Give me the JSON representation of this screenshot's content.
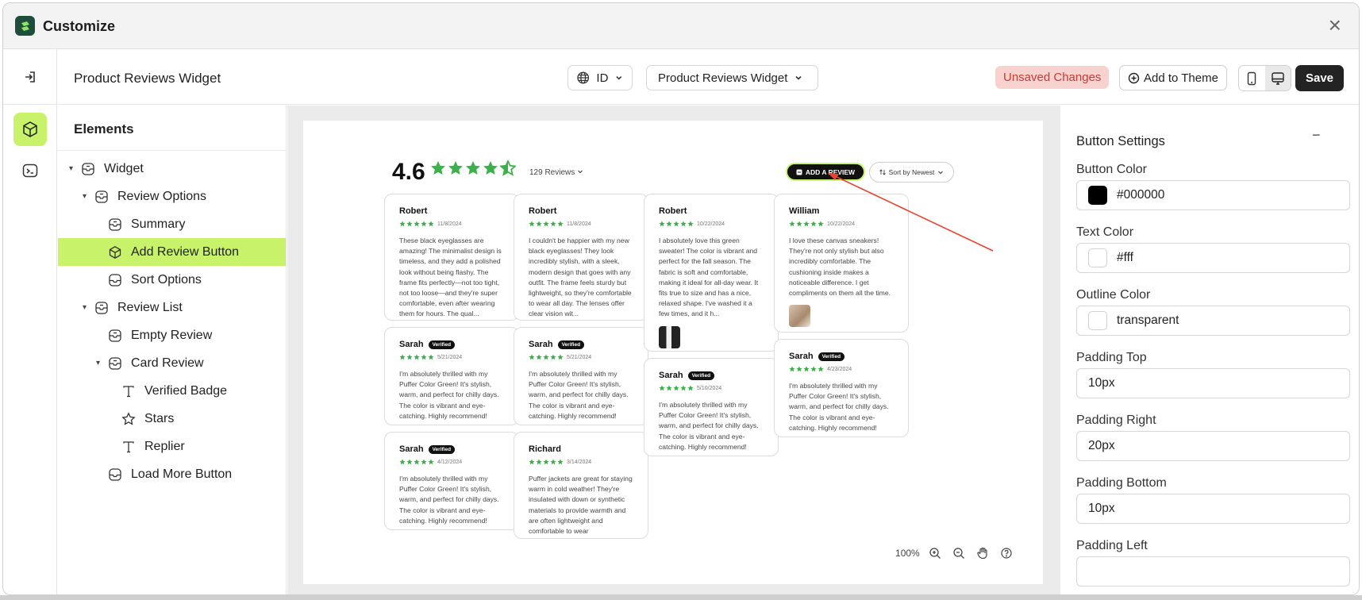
{
  "window": {
    "title": "Customize",
    "close_glyph": "×"
  },
  "header": {
    "page_title": "Product Reviews Widget",
    "language": "ID",
    "widget_select": "Product Reviews Widget",
    "unsaved": "Unsaved Changes",
    "add_to_theme": "Add to Theme",
    "save": "Save"
  },
  "elements": {
    "title": "Elements",
    "tree": [
      {
        "label": "Widget",
        "level": 0,
        "caret": true,
        "icon": "box-stack-icon"
      },
      {
        "label": "Review Options",
        "level": 1,
        "caret": true,
        "icon": "box-stack-icon"
      },
      {
        "label": "Summary",
        "level": 2,
        "caret": false,
        "icon": "box-stack-icon"
      },
      {
        "label": "Add Review Button",
        "level": 2,
        "caret": false,
        "icon": "cube-icon",
        "active": true
      },
      {
        "label": "Sort Options",
        "level": 2,
        "caret": false,
        "icon": "tray-icon"
      },
      {
        "label": "Review List",
        "level": 1,
        "caret": true,
        "icon": "box-stack-icon"
      },
      {
        "label": "Empty Review",
        "level": 2,
        "caret": false,
        "icon": "box-stack-icon"
      },
      {
        "label": "Card Review",
        "level": 2,
        "caret": true,
        "icon": "box-stack-icon"
      },
      {
        "label": "Verified Badge",
        "level": 3,
        "caret": false,
        "icon": "text-icon"
      },
      {
        "label": "Stars",
        "level": 3,
        "caret": false,
        "icon": "star-icon"
      },
      {
        "label": "Replier",
        "level": 3,
        "caret": false,
        "icon": "text-icon"
      },
      {
        "label": "Load More Button",
        "level": 2,
        "caret": false,
        "icon": "tray-icon"
      }
    ]
  },
  "preview": {
    "rating": "4.6",
    "review_count": "129 Reviews",
    "add_review": "ADD A REVIEW",
    "sort": "Sort by Newest",
    "star_color": "#3cb04a",
    "columns": [
      [
        {
          "name": "Robert",
          "verified": false,
          "date": "11/8/2024",
          "text": "These black eyeglasses are amazing! The minimalist design is timeless, and they add a polished look without being flashy. The frame fits perfectly—not too tight, not too loose—and they're super comfortable, even after wearing them for hours. The qual...",
          "thumb": null
        },
        {
          "name": "Sarah",
          "verified": true,
          "date": "5/21/2024",
          "text": "I'm absolutely thrilled with my Puffer Color Green! It's stylish, warm, and perfect for chilly days. The color is vibrant and eye-catching. Highly recommend!",
          "thumb": null
        },
        {
          "name": "Sarah",
          "verified": true,
          "date": "4/12/2024",
          "text": "I'm absolutely thrilled with my Puffer Color Green! It's stylish, warm, and perfect for chilly days. The color is vibrant and eye-catching. Highly recommend!",
          "thumb": null
        }
      ],
      [
        {
          "name": "Robert",
          "verified": false,
          "date": "11/8/2024",
          "text": "I couldn't be happier with my new black eyeglasses! They look incredibly stylish, with a sleek, modern design that goes with any outfit. The frame feels sturdy but lightweight, so they're comfortable to wear all day. The lenses offer clear vision wit...",
          "thumb": null
        },
        {
          "name": "Sarah",
          "verified": true,
          "date": "5/21/2024",
          "text": "I'm absolutely thrilled with my Puffer Color Green! It's stylish, warm, and perfect for chilly days. The color is vibrant and eye-catching. Highly recommend!",
          "thumb": null
        },
        {
          "name": "Richard",
          "verified": false,
          "date": "3/14/2024",
          "text": "Puffer jackets are great for staying warm in cold weather! They're insulated with down or synthetic materials to provide warmth and are often lightweight and comfortable to wear",
          "thumb": null
        }
      ],
      [
        {
          "name": "Robert",
          "verified": false,
          "date": "10/22/2024",
          "text": "I absolutely love this green sweater! The color is vibrant and perfect for the fall season. The fabric is soft and comfortable, making it ideal for all-day wear. It fits true to size and has a nice, relaxed shape. I've washed it a few times, and it h...",
          "thumb": "dark"
        },
        {
          "name": "Sarah",
          "verified": true,
          "date": "5/10/2024",
          "text": "I'm absolutely thrilled with my Puffer Color Green! It's stylish, warm, and perfect for chilly days. The color is vibrant and eye-catching. Highly recommend!",
          "thumb": null
        }
      ],
      [
        {
          "name": "William",
          "verified": false,
          "date": "10/22/2024",
          "text": "I love these canvas sneakers! They're not only stylish but also incredibly comfortable. The cushioning inside makes a noticeable difference. I get compliments on them all the time.",
          "thumb": "light"
        },
        {
          "name": "Sarah",
          "verified": true,
          "date": "4/23/2024",
          "text": "I'm absolutely thrilled with my Puffer Color Green! It's stylish, warm, and perfect for chilly days. The color is vibrant and eye-catching. Highly recommend!",
          "thumb": null
        }
      ]
    ],
    "verified_label": "Verified",
    "zoom": "100%"
  },
  "settings": {
    "section_title": "Button Settings",
    "collapse_glyph": "−",
    "fields": [
      {
        "label": "Button Color",
        "value": "#000000",
        "swatch": "#000000"
      },
      {
        "label": "Text Color",
        "value": "#fff",
        "swatch": "#ffffff"
      },
      {
        "label": "Outline Color",
        "value": "transparent",
        "swatch": "#ffffff"
      },
      {
        "label": "Padding Top",
        "value": "10px"
      },
      {
        "label": "Padding Right",
        "value": "20px"
      },
      {
        "label": "Padding Bottom",
        "value": "10px"
      },
      {
        "label": "Padding Left",
        "value": ""
      }
    ]
  },
  "colors": {
    "accent": "#c7f26a",
    "annotation": "#e8442e",
    "save_bg": "#232323",
    "unsaved_bg": "#f8d2cf",
    "unsaved_text": "#c73b32"
  }
}
